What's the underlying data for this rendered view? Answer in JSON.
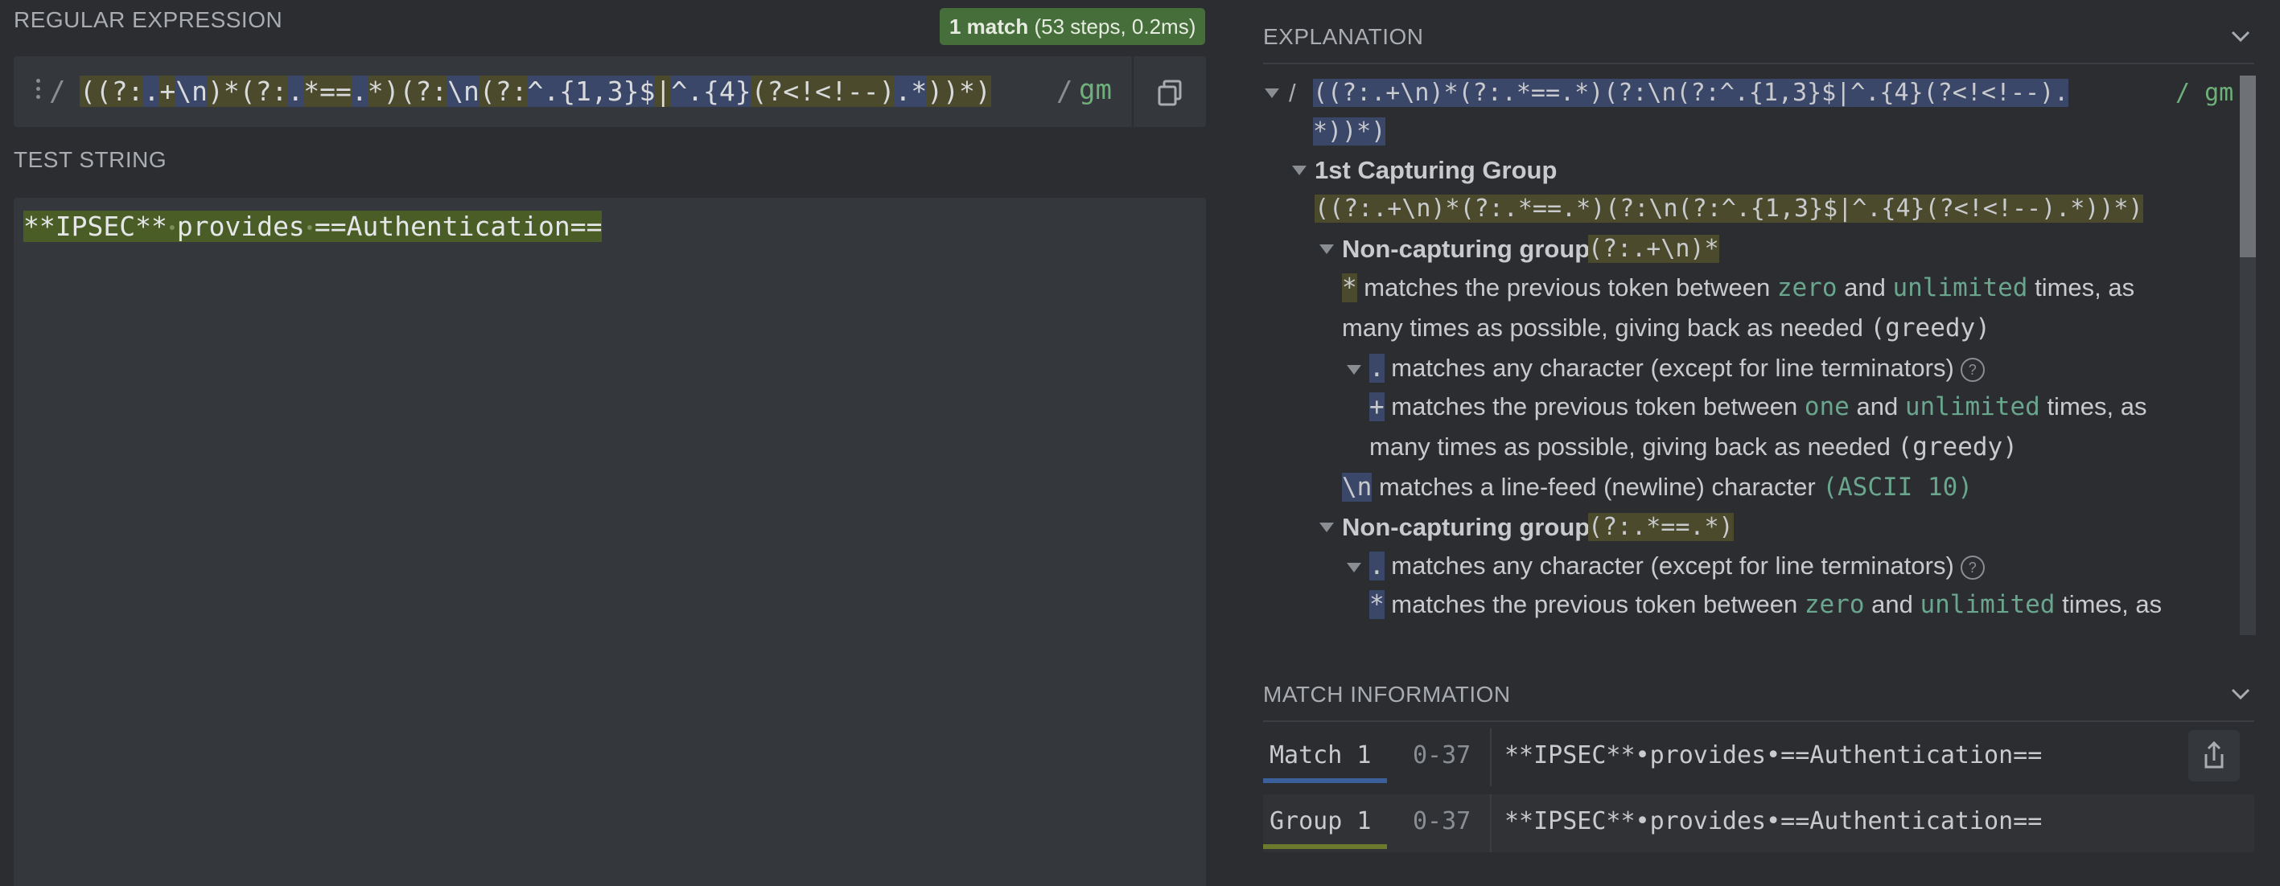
{
  "regex_section": {
    "title": "REGULAR EXPRESSION",
    "match_count": "1 match",
    "match_detail": "(53 steps, 0.2ms)",
    "delimiter_open": "/",
    "delimiter_close": "/",
    "flags": "gm",
    "pattern_tokens": [
      "(",
      "(?:",
      ".",
      "+",
      "\\n",
      ")",
      "*",
      "(?:",
      ".",
      "*",
      "==",
      ".",
      "*",
      ")",
      "(?:",
      "\\n",
      "(?:",
      "^",
      ".",
      "{1,3}",
      "$",
      "|",
      "^",
      ".",
      "{4}",
      "(?<!<!--)",
      ".",
      "*",
      ")",
      ")",
      "*",
      ")"
    ]
  },
  "test_section": {
    "title": "TEST STRING",
    "parts": [
      "**IPSEC**",
      "provides",
      "==Authentication=="
    ],
    "space_glyph": "•"
  },
  "explanation": {
    "title": "EXPLANATION",
    "root_delim": "/",
    "root_pattern_line1": "((?:.+\\n)*(?:.*==.*)(?:\\n(?:^.{1,3}$|^.{4}(?<!<!--).",
    "root_pattern_line2": "*))*)",
    "root_flags": "/ gm",
    "group1_title": "1st Capturing Group",
    "group1_pattern": "((?:.+\\n)*(?:.*==.*)(?:\\n(?:^.{1,3}$|^.{4}(?<!<!--).*))*)",
    "ncg_title": "Non-capturing group",
    "ncg1_pattern": "(?:.+\\n)*",
    "star_token": "*",
    "quant_star_text_a": "matches the previous token between",
    "zero": "zero",
    "and": "and",
    "unlimited": "unlimited",
    "times_as": "times, as",
    "greedy_text": "many times as possible, giving back as needed",
    "greedy": "(greedy)",
    "dot_token": ".",
    "dot_text": "matches any character (except for line terminators)",
    "help_glyph": "?",
    "plus_token": "+",
    "one": "one",
    "newline_token": "\\n",
    "newline_text": "matches a line-feed (newline) character",
    "ascii": "(ASCII 10)",
    "ncg2_pattern": "(?:.*==.*)"
  },
  "match_info": {
    "title": "MATCH INFORMATION",
    "rows": [
      {
        "label": "Match 1",
        "range": "0-37",
        "value": "**IPSEC**•provides•==Authentication==",
        "color": "#3b5f9a"
      },
      {
        "label": "Group 1",
        "range": "0-37",
        "value": "**IPSEC**•provides•==Authentication==",
        "color": "#6b7a2c"
      }
    ]
  },
  "colors": {
    "accent_green": "#456e3b",
    "group_highlight": "#4b4a2c",
    "token_highlight": "#3b4768",
    "match_highlight": "#4a5d26"
  }
}
